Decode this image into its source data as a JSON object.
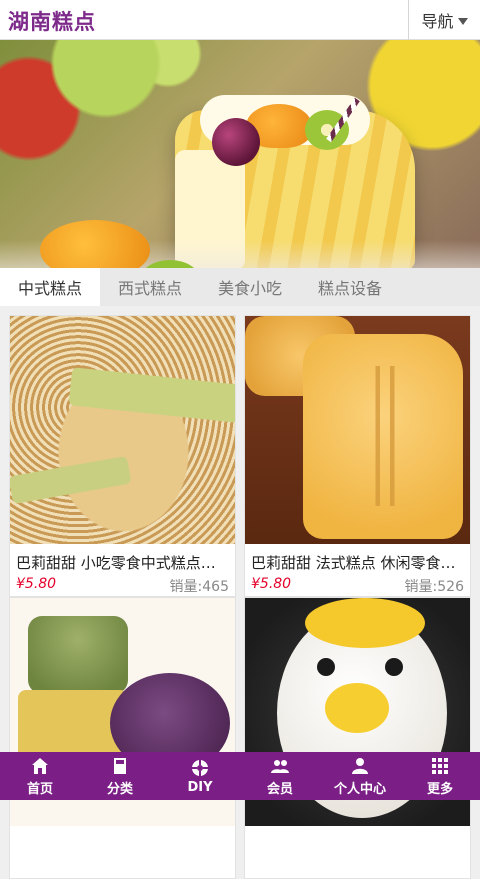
{
  "header": {
    "logo_text": "湖南糕点",
    "nav_label": "导航"
  },
  "banner": {
    "slide_count": 3,
    "active_slide": 2
  },
  "tabs": [
    {
      "label": "中式糕点",
      "active": true
    },
    {
      "label": "西式糕点",
      "active": false
    },
    {
      "label": "美食小吃",
      "active": false
    },
    {
      "label": "糕点设备",
      "active": false
    }
  ],
  "products": [
    {
      "name": "巴莉甜甜 小吃零食中式糕点手工酥",
      "price": "¥5.80",
      "sales": "销量:465"
    },
    {
      "name": "巴莉甜甜 法式糕点 休闲零食蛋糕",
      "price": "¥5.80",
      "sales": "销量:526"
    },
    {
      "name": "",
      "price": "",
      "sales": ""
    },
    {
      "name": "",
      "price": "",
      "sales": ""
    }
  ],
  "bottom_nav": [
    {
      "label": "首页",
      "icon": "home-icon"
    },
    {
      "label": "分类",
      "icon": "category-icon"
    },
    {
      "label": "DIY",
      "icon": "diy-icon"
    },
    {
      "label": "会员",
      "icon": "members-icon"
    },
    {
      "label": "个人中心",
      "icon": "user-icon"
    },
    {
      "label": "更多",
      "icon": "grid-icon"
    }
  ],
  "colors": {
    "brand": "#7b1e86",
    "price": "#e4002b"
  }
}
